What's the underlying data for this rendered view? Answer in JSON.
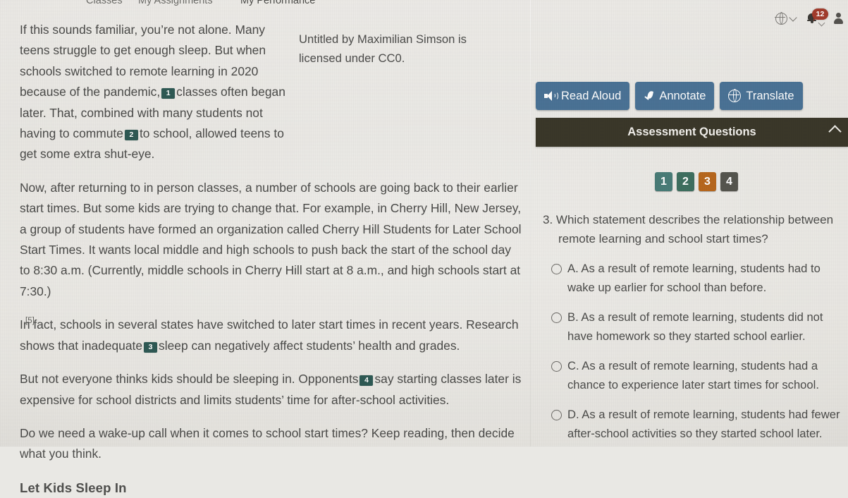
{
  "nav": {
    "items": [
      {
        "label": "Classes",
        "active": false
      },
      {
        "label": "My Assignments",
        "active": false
      },
      {
        "label": "My Performance",
        "active": true
      }
    ]
  },
  "topbar": {
    "language_icon": "globe-icon",
    "language_chevron": "chevron-down-icon",
    "notifications_icon": "bell-icon",
    "notifications_count": "12",
    "notifications_chevron": "chevron-down-icon",
    "account_icon": "user-avatar-icon"
  },
  "article": {
    "paragraphs": [
      {
        "number": "",
        "parts": [
          {
            "type": "text",
            "value": "If this sounds familiar, you’re not alone. Many teens struggle to get enough sleep. But when schools switched to remote learning in 2020 because of the pandemic,"
          },
          {
            "type": "marker",
            "value": "1"
          },
          {
            "type": "text",
            "value": "classes often began later. That, combined with many students not having to commute"
          },
          {
            "type": "marker",
            "value": "2"
          },
          {
            "type": "text",
            "value": "to school, allowed teens to get some extra shut-eye."
          }
        ]
      },
      {
        "number": "",
        "parts": [
          {
            "type": "text",
            "value": "Now, after returning to in person classes, a number of schools are going back to their earlier start times. But some kids are trying to change that. For example, in Cherry Hill, New Jersey, a group of students have formed an organization called Cherry Hill Students for Later School Start Times. It wants local middle and high schools to push back the start of the school day to 8:30 a.m. (Currently, middle schools in Cherry Hill start at 8 a.m., and high schools start at 7:30.)"
          }
        ]
      },
      {
        "number": "[5]",
        "parts": [
          {
            "type": "text",
            "value": "In fact, schools in several states have switched to later start times in recent years. Research shows that inadequate"
          },
          {
            "type": "marker",
            "value": "3"
          },
          {
            "type": "text",
            "value": "sleep can negatively affect students’ health and grades."
          }
        ]
      },
      {
        "number": "",
        "parts": [
          {
            "type": "text",
            "value": "But not everyone thinks kids should be sleeping in. Opponents"
          },
          {
            "type": "marker",
            "value": "4"
          },
          {
            "type": "text",
            "value": "say starting classes later is expensive for school districts and limits students’ time for after-school activities."
          }
        ]
      },
      {
        "number": "",
        "parts": [
          {
            "type": "text",
            "value": "Do we need a wake-up call when it comes to school start times? Keep reading, then decide what you think."
          }
        ]
      }
    ],
    "subheading": "Let Kids Sleep In",
    "image_caption": "Untitled by Maximilian Simson is licensed under CC0."
  },
  "panel": {
    "tools": [
      {
        "label": "Read Aloud",
        "icon": "speaker-icon"
      },
      {
        "label": "Annotate",
        "icon": "pen-icon"
      },
      {
        "label": "Translate",
        "icon": "globe-icon"
      }
    ],
    "section_title": "Assessment Questions",
    "section_collapse_icon": "chevron-up-icon",
    "question_tabs": [
      {
        "label": "1",
        "color": "#4a7d78",
        "active": false
      },
      {
        "label": "2",
        "color": "#3f7060",
        "active": false
      },
      {
        "label": "3",
        "color": "#b8681e",
        "active": true
      },
      {
        "label": "4",
        "color": "#56564f",
        "active": false
      }
    ],
    "question": {
      "number": "3.",
      "line1": "Which statement describes the relationship between",
      "line2": "remote learning and school start times?",
      "options": [
        {
          "letter": "A.",
          "text": "As a result of remote learning, students had to wake up earlier for school than before.",
          "selected": false
        },
        {
          "letter": "B.",
          "text": "As a result of remote learning, students did not have homework so they started school earlier.",
          "selected": false
        },
        {
          "letter": "C.",
          "text": "As a result of remote learning, students had a chance to experience later start times for school.",
          "selected": false
        },
        {
          "letter": "D.",
          "text": "As a result of remote learning, students had fewer after-school activities so they started school later.",
          "selected": false
        }
      ]
    }
  },
  "colors": {
    "tool_button": "#4b7396",
    "assessment_bar": "#3b382a",
    "inline_marker": "#2f5a55",
    "badge": "#a33c2c",
    "page_background": "#e9e7e2"
  }
}
